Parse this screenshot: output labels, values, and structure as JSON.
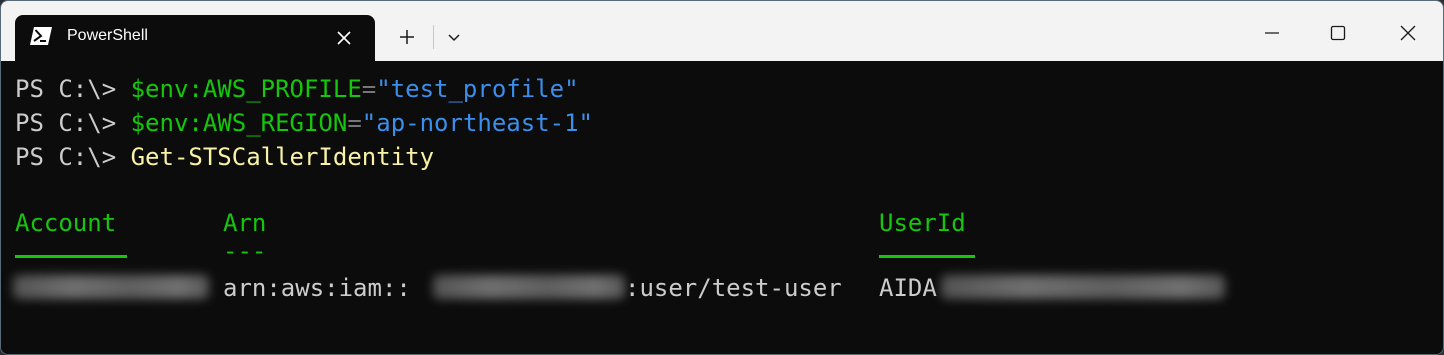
{
  "window": {
    "tab_title": "PowerShell",
    "tab_icon": "powershell-icon",
    "new_tab_glyph": "+",
    "dropdown_icon": "chevron-down-icon",
    "controls": [
      "minimize-icon",
      "maximize-icon",
      "close-icon"
    ]
  },
  "terminal": {
    "lines": [
      {
        "prompt": "PS C:\\> ",
        "variable": "$env:AWS_PROFILE",
        "operator": "=",
        "string": "\"test_profile\""
      },
      {
        "prompt": "PS C:\\> ",
        "variable": "$env:AWS_REGION",
        "operator": "=",
        "string": "\"ap-northeast-1\""
      },
      {
        "prompt": "PS C:\\> ",
        "command": "Get-STSCallerIdentity"
      }
    ],
    "table": {
      "headers": [
        "Account",
        "Arn",
        "UserId"
      ],
      "arn_underline": "---",
      "row": {
        "arn_prefix": "arn:aws:iam::",
        "arn_suffix": ":user/test-user",
        "userid_prefix": "AIDA"
      }
    }
  },
  "colors": {
    "background": "#0c0c0c",
    "titlebar": "#f3f3f3",
    "variable_green": "#16c60c",
    "string_blue": "#3b8eea",
    "command_yellow": "#f9f1a5",
    "text_gray": "#cccccc"
  }
}
